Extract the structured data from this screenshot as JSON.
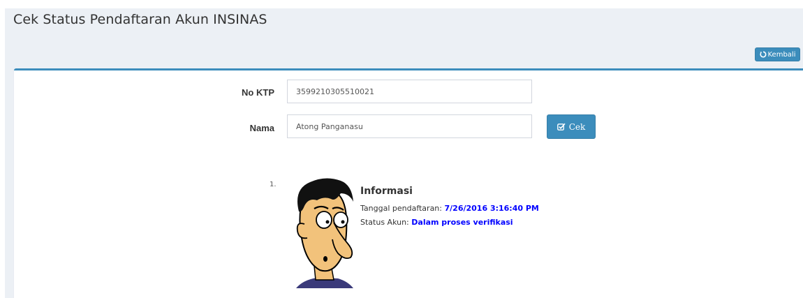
{
  "header": {
    "title": "Cek Status Pendaftaran Akun INSINAS",
    "back_button_label": "Kembali"
  },
  "form": {
    "ktp_label": "No KTP",
    "ktp_value": "3599210305510021",
    "nama_label": "Nama",
    "nama_value": "Atong Panganasu",
    "cek_button_label": "Cek"
  },
  "result": {
    "number": "1.",
    "title": "Informasi",
    "registration_date_label": "Tanggal pendaftaran:",
    "registration_date_value": "7/26/2016 3:16:40 PM",
    "status_label": "Status Akun:",
    "status_value": "Dalam proses verifikasi"
  },
  "icons": {
    "back": "refresh-icon",
    "cek": "check-square-icon",
    "avatar": "cartoon-face-avatar"
  },
  "colors": {
    "primary": "#3c8dbc",
    "value_text": "#0000ff",
    "page_background": "#ecf0f5"
  }
}
